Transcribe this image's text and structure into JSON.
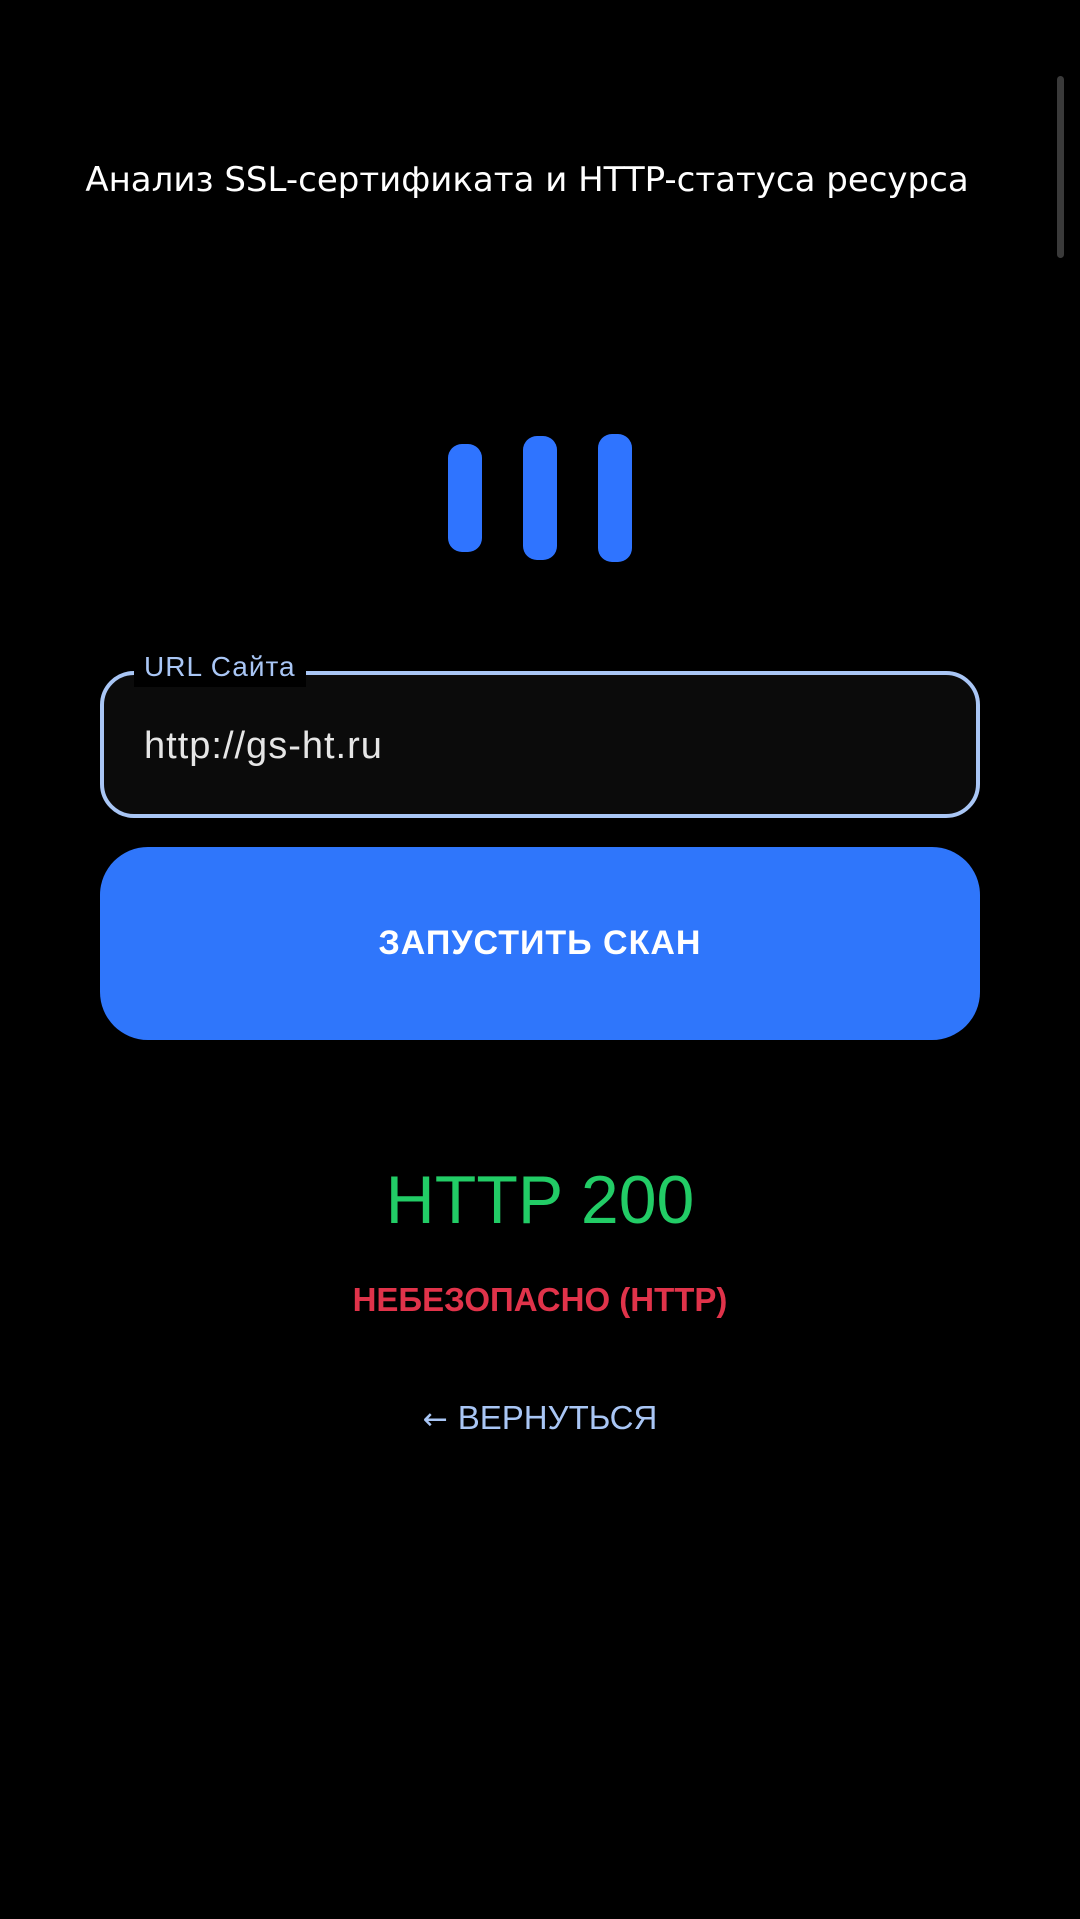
{
  "header": {
    "title": "Анализ SSL-сертификата и HTTP-статуса ресурса"
  },
  "logo": {
    "icon": "three-bars-logo-icon",
    "color": "#2f74ff"
  },
  "url_field": {
    "label": "URL Сайта",
    "value": "http://gs-ht.ru",
    "border_color": "#a9c6f5"
  },
  "scan_button": {
    "label": "ЗАПУСТИТЬ СКАН",
    "color": "#2f76fb"
  },
  "result": {
    "status_code": "HTTP 200",
    "status_code_color": "#22cc66",
    "security": "НЕБЕЗОПАСНО (HTTP)",
    "security_color": "#e0334a"
  },
  "back": {
    "arrow_icon": "arrow-left-icon",
    "arrow": "←",
    "label": "ВЕРНУТЬСЯ"
  }
}
